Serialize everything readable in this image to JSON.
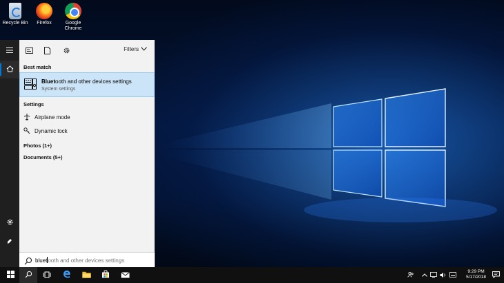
{
  "desktop": {
    "icons": [
      {
        "label": "Recycle Bin",
        "icon": "recycle-bin-icon"
      },
      {
        "label": "Firefox",
        "icon": "firefox-icon"
      },
      {
        "label": "Google Chrome",
        "icon": "chrome-icon"
      }
    ]
  },
  "rail": {
    "items": [
      {
        "name": "hamburger-menu",
        "icon": "menu-icon"
      },
      {
        "name": "home",
        "icon": "home-icon"
      },
      {
        "name": "settings",
        "icon": "gear-icon"
      },
      {
        "name": "feedback",
        "icon": "feedback-icon"
      }
    ]
  },
  "panel": {
    "top_icons": [
      "apps-icon",
      "documents-icon",
      "settings-icon"
    ],
    "filters_label": "Filters",
    "best_match_header": "Best match",
    "best_match": {
      "title_bold": "Bluet",
      "title_rest": "ooth and other devices settings",
      "subtitle": "System settings",
      "icon": "bluetooth-device-icon"
    },
    "settings_header": "Settings",
    "settings_items": [
      {
        "label": "Airplane mode",
        "icon": "airplane-icon"
      },
      {
        "label": "Dynamic lock",
        "icon": "key-icon"
      }
    ],
    "photos_header": "Photos (1+)",
    "documents_header": "Documents (5+)"
  },
  "search": {
    "typed": "bluet",
    "suggestion": "ooth and other devices settings"
  },
  "taskbar": {
    "apps": [
      "start-icon",
      "search-icon",
      "task-view-icon",
      "edge-icon",
      "file-explorer-icon",
      "store-icon",
      "mail-icon"
    ],
    "time": "9:29 PM",
    "date": "5/17/2018"
  },
  "colors": {
    "accent": "#0078d7",
    "highlight": "#cce4f7"
  }
}
